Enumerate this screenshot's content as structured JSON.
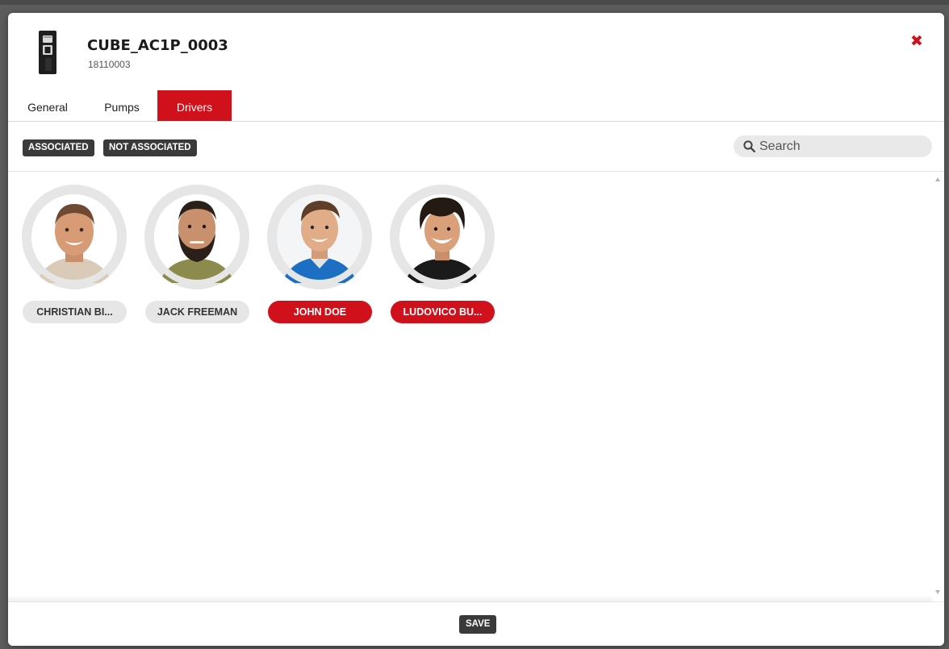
{
  "device": {
    "name": "CUBE_AC1P_0003",
    "serial": "18110003",
    "icon": "fuel-pump-device-icon"
  },
  "close_icon": "close-icon",
  "tabs": [
    {
      "label": "General",
      "active": false
    },
    {
      "label": "Pumps",
      "active": false
    },
    {
      "label": "Drivers",
      "active": true
    }
  ],
  "filters": {
    "associated_label": "ASSOCIATED",
    "not_associated_label": "NOT ASSOCIATED"
  },
  "search": {
    "placeholder": "Search",
    "value": "",
    "icon": "search-icon"
  },
  "drivers": [
    {
      "name": "CHRISTIAN BI...",
      "selected": false
    },
    {
      "name": "JACK FREEMAN",
      "selected": false
    },
    {
      "name": "JOHN DOE",
      "selected": true
    },
    {
      "name": "LUDOVICO BU...",
      "selected": true
    }
  ],
  "footer": {
    "save_label": "SAVE"
  },
  "colors": {
    "accent": "#d0111b",
    "dark_button": "#3a3a3a",
    "pill_inactive": "#e6e6e6",
    "avatar_ring": "#e6e6e6"
  }
}
